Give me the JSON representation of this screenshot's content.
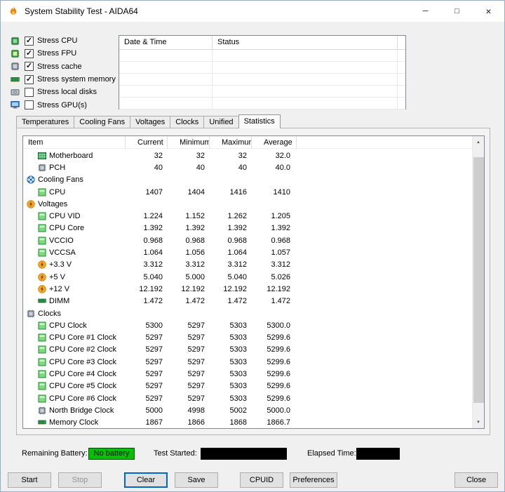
{
  "window": {
    "title": "System Stability Test - AIDA64",
    "icons": {
      "minimize": "─",
      "maximize": "□",
      "close": "×",
      "scroll_up": "▲",
      "scroll_down": "▼",
      "check": "✓"
    }
  },
  "stress_options": [
    {
      "label": "Stress CPU",
      "checked": true,
      "icon": "cpu-stress-icon"
    },
    {
      "label": "Stress FPU",
      "checked": true,
      "icon": "fpu-stress-icon"
    },
    {
      "label": "Stress cache",
      "checked": true,
      "icon": "cache-stress-icon"
    },
    {
      "label": "Stress system memory",
      "checked": true,
      "icon": "sysmem-stress-icon"
    },
    {
      "label": "Stress local disks",
      "checked": false,
      "icon": "disk-stress-icon"
    },
    {
      "label": "Stress GPU(s)",
      "checked": false,
      "icon": "gpu-stress-icon"
    }
  ],
  "log": {
    "columns": [
      "Date & Time",
      "Status"
    ],
    "rows": []
  },
  "tabs": {
    "items": [
      "Temperatures",
      "Cooling Fans",
      "Voltages",
      "Clocks",
      "Unified",
      "Statistics"
    ],
    "active": "Statistics"
  },
  "stats_table": {
    "columns": [
      "Item",
      "Current",
      "Minimum",
      "Maximum",
      "Average"
    ],
    "rows": [
      {
        "label": "Motherboard",
        "icon": "motherboard-icon",
        "group": false,
        "values": [
          "32",
          "32",
          "32",
          "32.0"
        ]
      },
      {
        "label": "PCH",
        "icon": "chip-icon",
        "group": false,
        "values": [
          "40",
          "40",
          "40",
          "40.0"
        ]
      },
      {
        "label": "Cooling Fans",
        "icon": "fan-icon",
        "group": true,
        "values": [
          "",
          "",
          "",
          ""
        ]
      },
      {
        "label": "CPU",
        "icon": "green-led-icon",
        "group": false,
        "values": [
          "1407",
          "1404",
          "1416",
          "1410"
        ]
      },
      {
        "label": "Voltages",
        "icon": "lightning-icon",
        "group": true,
        "values": [
          "",
          "",
          "",
          ""
        ]
      },
      {
        "label": "CPU VID",
        "icon": "green-led-icon",
        "group": false,
        "values": [
          "1.224",
          "1.152",
          "1.262",
          "1.205"
        ]
      },
      {
        "label": "CPU Core",
        "icon": "green-led-icon",
        "group": false,
        "values": [
          "1.392",
          "1.392",
          "1.392",
          "1.392"
        ]
      },
      {
        "label": "VCCIO",
        "icon": "green-led-icon",
        "group": false,
        "values": [
          "0.968",
          "0.968",
          "0.968",
          "0.968"
        ]
      },
      {
        "label": "VCCSA",
        "icon": "green-led-icon",
        "group": false,
        "values": [
          "1.064",
          "1.056",
          "1.064",
          "1.057"
        ]
      },
      {
        "label": "+3.3 V",
        "icon": "lightning-icon",
        "group": false,
        "values": [
          "3.312",
          "3.312",
          "3.312",
          "3.312"
        ]
      },
      {
        "label": "+5 V",
        "icon": "lightning-icon",
        "group": false,
        "values": [
          "5.040",
          "5.000",
          "5.040",
          "5.026"
        ]
      },
      {
        "label": "+12 V",
        "icon": "lightning-icon",
        "group": false,
        "values": [
          "12.192",
          "12.192",
          "12.192",
          "12.192"
        ]
      },
      {
        "label": "DIMM",
        "icon": "memory-icon",
        "group": false,
        "values": [
          "1.472",
          "1.472",
          "1.472",
          "1.472"
        ]
      },
      {
        "label": "Clocks",
        "icon": "chip-icon",
        "group": true,
        "values": [
          "",
          "",
          "",
          ""
        ]
      },
      {
        "label": "CPU Clock",
        "icon": "green-led-icon",
        "group": false,
        "values": [
          "5300",
          "5297",
          "5303",
          "5300.0"
        ]
      },
      {
        "label": "CPU Core #1 Clock",
        "icon": "green-led-icon",
        "group": false,
        "values": [
          "5297",
          "5297",
          "5303",
          "5299.6"
        ]
      },
      {
        "label": "CPU Core #2 Clock",
        "icon": "green-led-icon",
        "group": false,
        "values": [
          "5297",
          "5297",
          "5303",
          "5299.6"
        ]
      },
      {
        "label": "CPU Core #3 Clock",
        "icon": "green-led-icon",
        "group": false,
        "values": [
          "5297",
          "5297",
          "5303",
          "5299.6"
        ]
      },
      {
        "label": "CPU Core #4 Clock",
        "icon": "green-led-icon",
        "group": false,
        "values": [
          "5297",
          "5297",
          "5303",
          "5299.6"
        ]
      },
      {
        "label": "CPU Core #5 Clock",
        "icon": "green-led-icon",
        "group": false,
        "values": [
          "5297",
          "5297",
          "5303",
          "5299.6"
        ]
      },
      {
        "label": "CPU Core #6 Clock",
        "icon": "green-led-icon",
        "group": false,
        "values": [
          "5297",
          "5297",
          "5303",
          "5299.6"
        ]
      },
      {
        "label": "North Bridge Clock",
        "icon": "chip-icon",
        "group": false,
        "values": [
          "5000",
          "4998",
          "5002",
          "5000.0"
        ]
      },
      {
        "label": "Memory Clock",
        "icon": "memory-icon",
        "group": false,
        "values": [
          "1867",
          "1866",
          "1868",
          "1866.7"
        ]
      }
    ]
  },
  "status_bar": {
    "remaining_battery_label": "Remaining Battery:",
    "battery_status": "No battery",
    "test_started_label": "Test Started:",
    "test_started_value": "",
    "elapsed_time_label": "Elapsed Time:",
    "elapsed_time_value": ""
  },
  "buttons": [
    {
      "id": "start",
      "label": "Start",
      "enabled": true,
      "focused": false
    },
    {
      "id": "stop",
      "label": "Stop",
      "enabled": false,
      "focused": false
    },
    {
      "id": "clear",
      "label": "Clear",
      "enabled": true,
      "focused": true
    },
    {
      "id": "save",
      "label": "Save",
      "enabled": true,
      "focused": false
    },
    {
      "id": "cpuid",
      "label": "CPUID",
      "enabled": true,
      "focused": false
    },
    {
      "id": "preferences",
      "label": "Preferences",
      "enabled": true,
      "focused": false
    },
    {
      "id": "close",
      "label": "Close",
      "enabled": true,
      "focused": false
    }
  ],
  "colors": {
    "battery_ok": "#00c300",
    "value_box": "#000000",
    "focus_border": "#0066cc",
    "flame_orange": "#f07f13"
  }
}
